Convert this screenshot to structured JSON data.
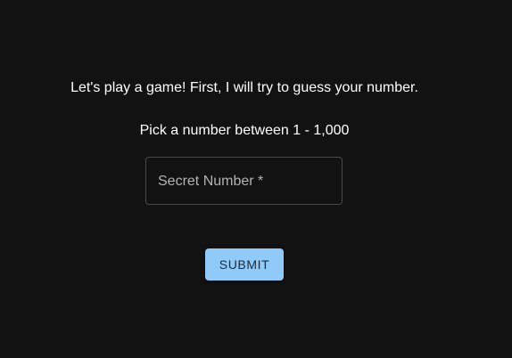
{
  "intro_text": "Let's play a game! First, I will try to guess your number.",
  "prompt_text": "Pick a number between 1 - 1,000",
  "secret_field": {
    "label": "Secret Number *",
    "value": ""
  },
  "submit_label": "SUBMIT",
  "colors": {
    "background": "#121212",
    "text": "#ffffff",
    "field_label": "#b3b3b3",
    "field_border": "#4a4a4a",
    "button_bg": "#90caf9",
    "button_text": "#1a2b3a"
  }
}
